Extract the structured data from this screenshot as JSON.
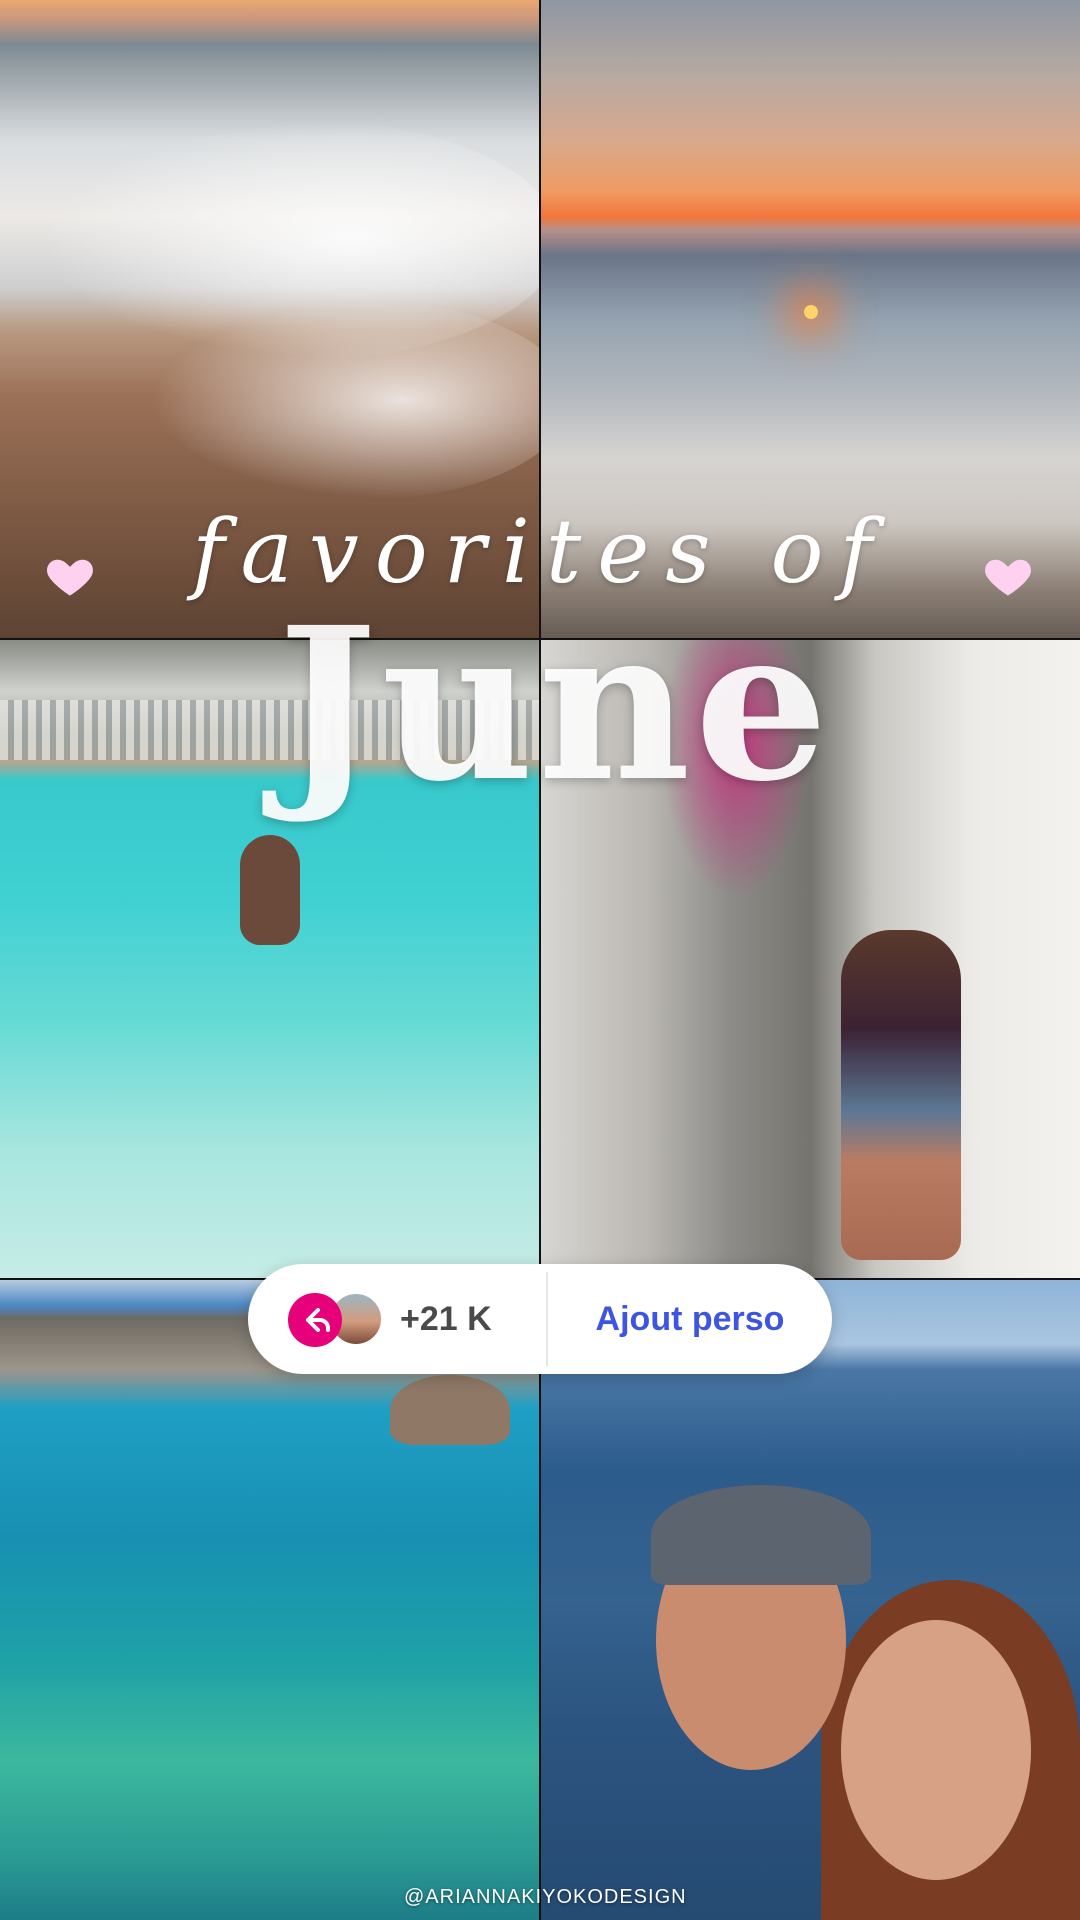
{
  "story": {
    "title_script": "favorites of",
    "title_main": "June",
    "photos": [
      {
        "scene": "waves-on-sand"
      },
      {
        "scene": "sunset-over-sea"
      },
      {
        "scene": "swimming-pool"
      },
      {
        "scene": "whitewashed-alley"
      },
      {
        "scene": "turquoise-cove"
      },
      {
        "scene": "couple-selfie"
      }
    ],
    "watermark": "@ARIANNAKIYOKODESIGN"
  },
  "share_bar": {
    "count_label": "+21 K",
    "action_label": "Ajout perso",
    "reply_icon": "reply-arrow-icon",
    "colors": {
      "reply": "#e6007a",
      "action": "#3d55e0"
    }
  },
  "colors": {
    "heart": "#ffd1f0"
  }
}
